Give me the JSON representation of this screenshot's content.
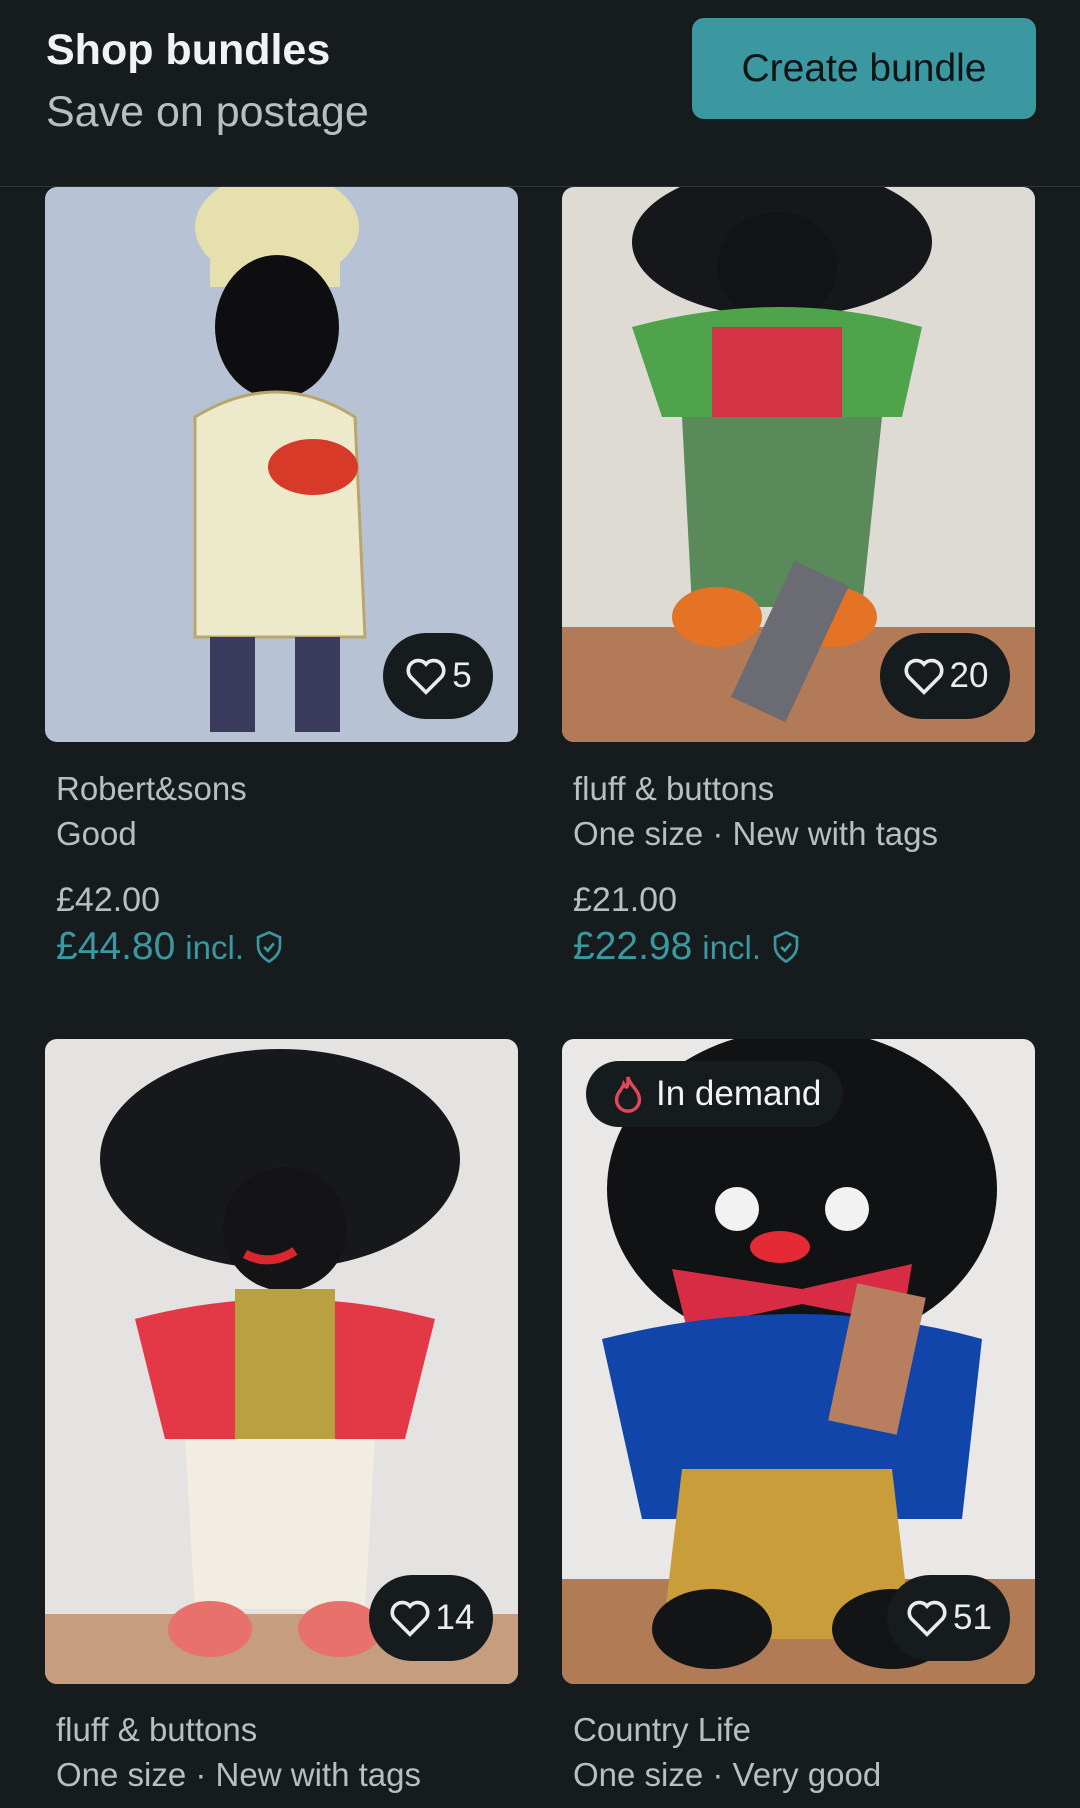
{
  "header": {
    "title": "Shop bundles",
    "subtitle": "Save on postage",
    "create_label": "Create bundle"
  },
  "items": [
    {
      "brand": "Robert&sons",
      "details": "Good",
      "price": "£42.00",
      "price_incl": "£44.80",
      "incl_label": "incl.",
      "favourites": "5"
    },
    {
      "brand": "fluff & buttons",
      "details": "One size · New with tags",
      "price": "£21.00",
      "price_incl": "£22.98",
      "incl_label": "incl.",
      "favourites": "20"
    },
    {
      "brand": "fluff & buttons",
      "details": "One size · New with tags",
      "favourites": "14"
    },
    {
      "brand": "Country Life",
      "details": "One size · Very good",
      "favourites": "51",
      "badge": "In demand"
    }
  ],
  "colors": {
    "accent": "#3b98a0",
    "background": "#161b1d",
    "badge_flame": "#e0475a"
  },
  "icons": {
    "favourite": "heart-icon",
    "buyer_protection": "shield-check-icon",
    "demand": "flame-icon"
  }
}
